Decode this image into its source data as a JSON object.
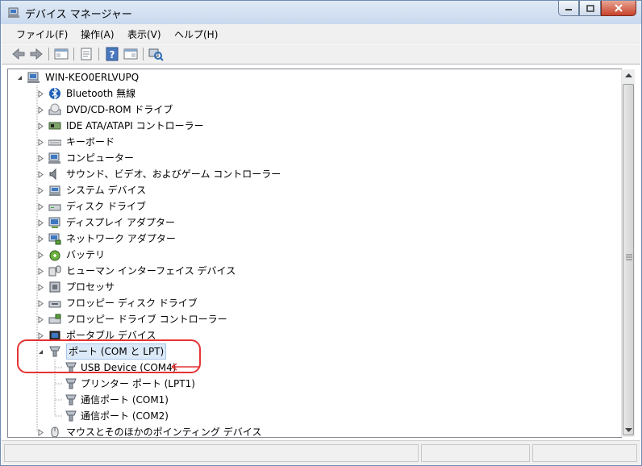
{
  "window": {
    "title": "デバイス マネージャー",
    "accent": "#e53333"
  },
  "menu": {
    "file": "ファイル(F)",
    "action": "操作(A)",
    "view": "表示(V)",
    "help": "ヘルプ(H)"
  },
  "tree": {
    "root": "WIN-KEO0ERLVUPQ",
    "categories": [
      {
        "label": "Bluetooth 無線",
        "icon": "bluetooth-icon"
      },
      {
        "label": "DVD/CD-ROM ドライブ",
        "icon": "dvd-drive-icon"
      },
      {
        "label": "IDE ATA/ATAPI コントローラー",
        "icon": "ide-controller-icon"
      },
      {
        "label": "キーボード",
        "icon": "keyboard-icon"
      },
      {
        "label": "コンピューター",
        "icon": "computer-icon"
      },
      {
        "label": "サウンド、ビデオ、およびゲーム コントローラー",
        "icon": "speaker-icon"
      },
      {
        "label": "システム デバイス",
        "icon": "system-device-icon"
      },
      {
        "label": "ディスク ドライブ",
        "icon": "disk-drive-icon"
      },
      {
        "label": "ディスプレイ アダプター",
        "icon": "display-adapter-icon"
      },
      {
        "label": "ネットワーク アダプター",
        "icon": "network-adapter-icon"
      },
      {
        "label": "バッテリ",
        "icon": "battery-icon"
      },
      {
        "label": "ヒューマン インターフェイス デバイス",
        "icon": "hid-icon"
      },
      {
        "label": "プロセッサ",
        "icon": "processor-icon"
      },
      {
        "label": "フロッピー ディスク ドライブ",
        "icon": "floppy-drive-icon"
      },
      {
        "label": "フロッピー ドライブ コントローラー",
        "icon": "floppy-controller-icon"
      },
      {
        "label": "ポータブル デバイス",
        "icon": "portable-device-icon"
      }
    ],
    "ports": {
      "label": "ポート (COM と LPT)",
      "children": [
        "USB Device (COM4)",
        "プリンター ポート (LPT1)",
        "通信ポート (COM1)",
        "通信ポート (COM2)"
      ]
    },
    "mouse": "マウスとそのほかのポインティング デバイス"
  }
}
